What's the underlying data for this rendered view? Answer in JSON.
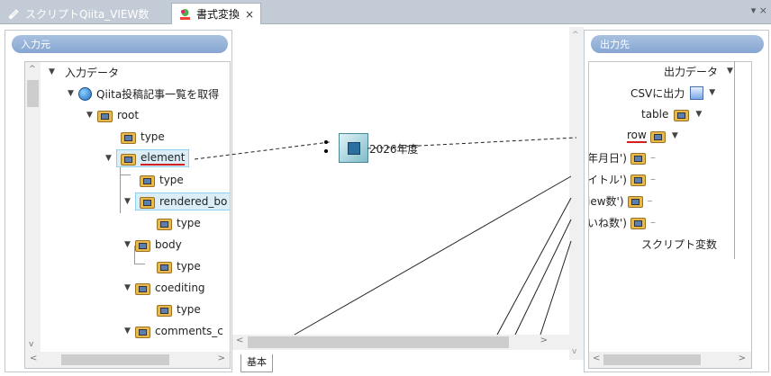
{
  "tabs": [
    {
      "label": "スクリプトQiita_VIEW数",
      "active": false
    },
    {
      "label": "書式変換",
      "active": true
    }
  ],
  "tab_close": "×",
  "tab_menu": "▾ ×",
  "left_panel": {
    "title": "入力元",
    "tree": [
      {
        "label": "入力データ"
      },
      {
        "label": "Qiita投稿記事一覧を取得"
      },
      {
        "label": "root"
      },
      {
        "label": "type"
      },
      {
        "label": "element"
      },
      {
        "label": "type"
      },
      {
        "label": "rendered_bo"
      },
      {
        "label": "type"
      },
      {
        "label": "body"
      },
      {
        "label": "type"
      },
      {
        "label": "coediting"
      },
      {
        "label": "type"
      },
      {
        "label": "comments_c"
      }
    ]
  },
  "center": {
    "function_label": "2026年度",
    "bottom_tab": "基本"
  },
  "right_panel": {
    "title": "出力先",
    "tree": [
      {
        "label": "出力データ"
      },
      {
        "label": "CSVに出力"
      },
      {
        "label": "table"
      },
      {
        "label": "row"
      },
      {
        "label": "年月日')"
      },
      {
        "label": "イトル')"
      },
      {
        "label": "iew数')"
      },
      {
        "label": "いね数')"
      },
      {
        "label": "スクリプト変数"
      }
    ]
  },
  "scroll_glyphs": {
    "up": "^",
    "down": "v",
    "left": "<",
    "right": ">"
  },
  "colors": {
    "tabbar": "#c3ccd6",
    "panel_head": "#86a6d2",
    "selection": "#dbeef8",
    "mapping_line": "#222222",
    "underline": "#d42020"
  }
}
